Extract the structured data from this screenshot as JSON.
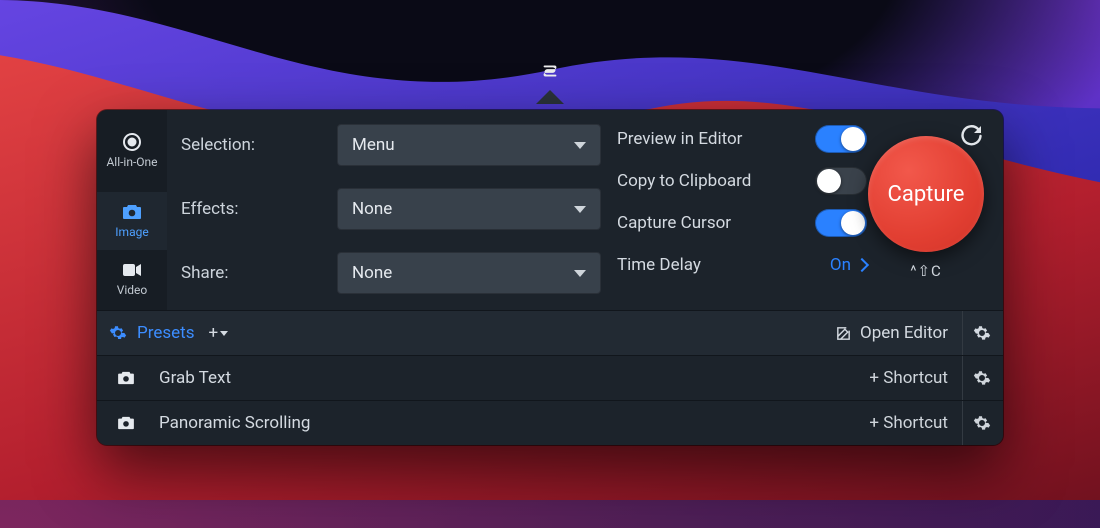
{
  "app_glyph": "S",
  "modes": {
    "all_in_one": {
      "label": "All-in-One",
      "selected": false
    },
    "image": {
      "label": "Image",
      "selected": true
    },
    "video": {
      "label": "Video",
      "selected": false
    }
  },
  "form": {
    "selection": {
      "label": "Selection:",
      "value": "Menu"
    },
    "effects": {
      "label": "Effects:",
      "value": "None"
    },
    "share": {
      "label": "Share:",
      "value": "None"
    }
  },
  "options": {
    "preview": {
      "label": "Preview in Editor",
      "on": true
    },
    "clipboard": {
      "label": "Copy to Clipboard",
      "on": false
    },
    "cursor": {
      "label": "Capture Cursor",
      "on": true
    },
    "delay": {
      "label": "Time Delay",
      "value": "On"
    }
  },
  "capture": {
    "label": "Capture",
    "shortcut": "^⇧C"
  },
  "presets_strip": {
    "label": "Presets",
    "add_label": "+",
    "open_editor_label": "Open Editor"
  },
  "presets": [
    {
      "name": "Grab Text",
      "shortcut_label": "+ Shortcut"
    },
    {
      "name": "Panoramic Scrolling",
      "shortcut_label": "+ Shortcut"
    }
  ]
}
